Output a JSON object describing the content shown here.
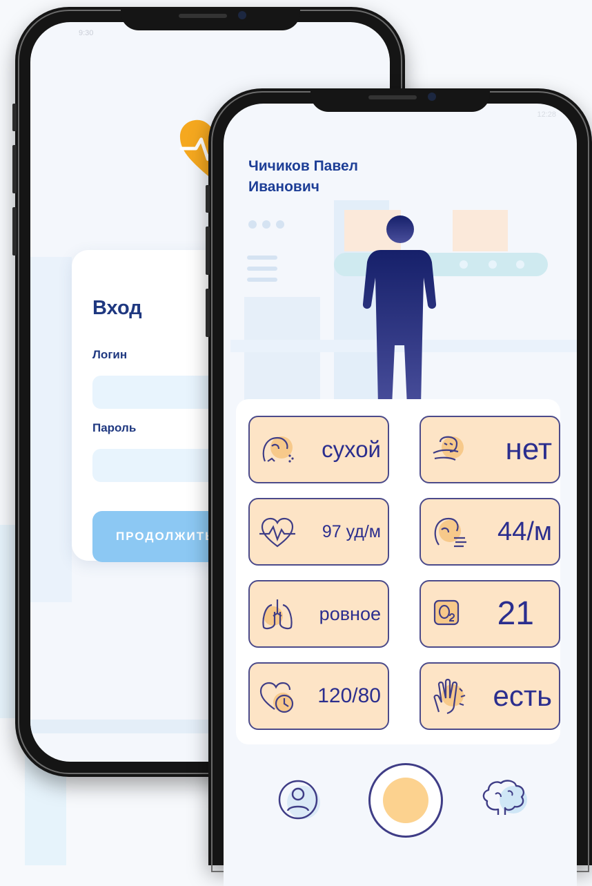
{
  "login": {
    "status_time": "9:30",
    "title": "Вход",
    "login_label": "Логин",
    "login_value": "",
    "password_label": "Пароль",
    "password_value": "",
    "continue_label": "ПРОДОЛЖИТЬ"
  },
  "patient": {
    "status_time": "12:28",
    "name": "Чичиков Павел Иванович",
    "metrics": [
      {
        "icon": "cough-icon",
        "value": "сухой"
      },
      {
        "icon": "nausea-icon",
        "value": "нет"
      },
      {
        "icon": "heart-rate-icon",
        "value": "97 уд/м"
      },
      {
        "icon": "breathing-rate-icon",
        "value": "44/м"
      },
      {
        "icon": "lungs-icon",
        "value": "ровное"
      },
      {
        "icon": "oxygen-icon",
        "value": "21"
      },
      {
        "icon": "blood-pressure-icon",
        "value": "120/80"
      },
      {
        "icon": "skin-icon",
        "value": "есть"
      }
    ],
    "nav": [
      "profile-icon",
      "record-button",
      "brain-icon"
    ]
  },
  "colors": {
    "accent_orange": "#f5a81f",
    "tile_bg": "#fde4c6",
    "tile_border": "#4b4a8a",
    "navy": "#1f3880",
    "button_blue": "#8cc8f3"
  }
}
